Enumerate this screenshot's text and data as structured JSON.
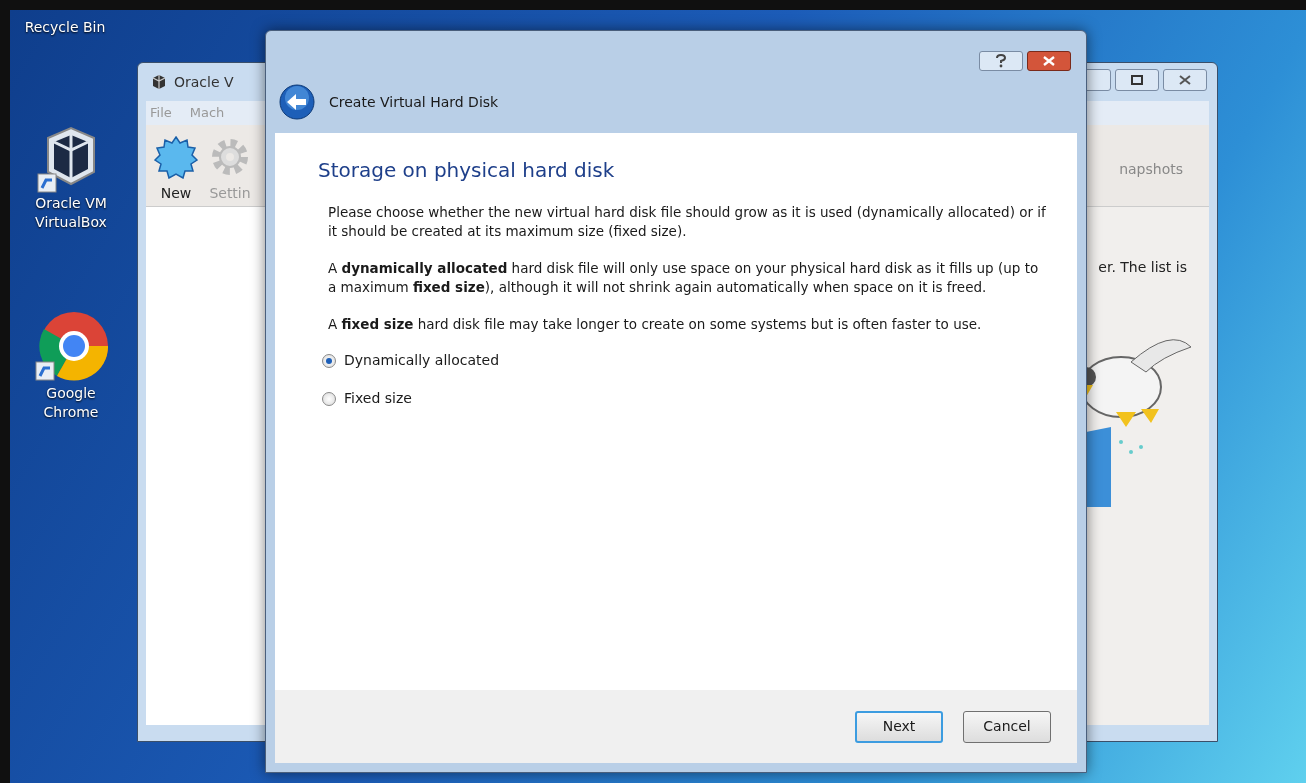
{
  "desktop_icons": [
    {
      "kind": "recycle",
      "label": "Recycle Bin"
    },
    {
      "kind": "virtualbox",
      "label": "Oracle VM VirtualBox"
    },
    {
      "kind": "chrome",
      "label": "Google Chrome"
    }
  ],
  "background_window": {
    "title": "Oracle V",
    "menu": [
      "File",
      "Mach"
    ],
    "toolbar": [
      {
        "kind": "new",
        "label": "New"
      },
      {
        "kind": "settings",
        "label": "Settin"
      }
    ],
    "tab_label": "napshots",
    "welcome_text": "er. The list is"
  },
  "dialog": {
    "title": "Create Virtual Hard Disk",
    "heading": "Storage on physical hard disk",
    "paragraphs": [
      "Please choose whether the new virtual hard disk file should grow as it is used (dynamically allocated) or if it should be created at its maximum size (fixed size).",
      "A **dynamically allocated** hard disk file will only use space on your physical hard disk as it fills up (up to a maximum **fixed size**), although it will not shrink again automatically when space on it is freed.",
      "A **fixed size** hard disk file may take longer to create on some systems but is often faster to use."
    ],
    "options": [
      {
        "label": "Dynamically allocated",
        "selected": true
      },
      {
        "label": "Fixed size",
        "selected": false
      }
    ],
    "buttons": [
      {
        "label": "Next",
        "default": true
      },
      {
        "label": "Cancel",
        "default": false
      }
    ]
  }
}
